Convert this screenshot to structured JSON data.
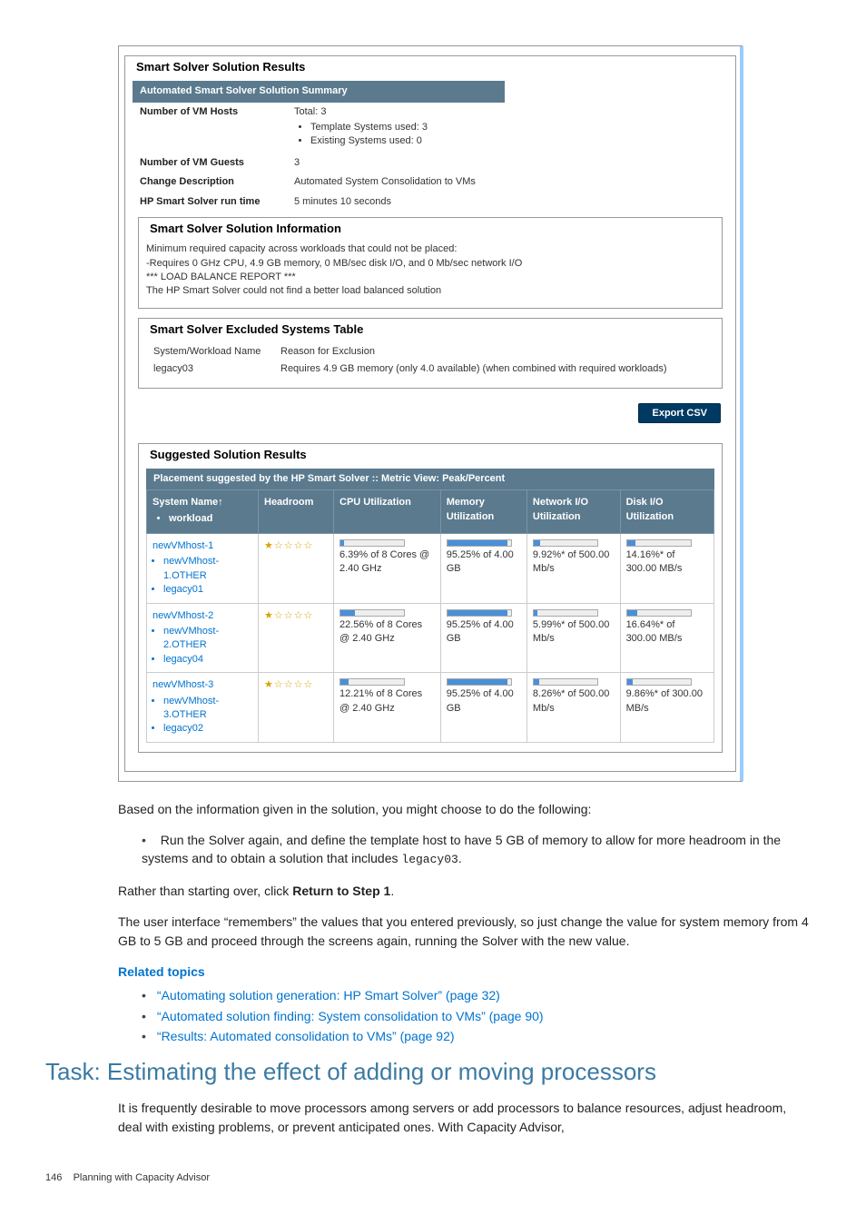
{
  "shot": {
    "mainLegend": "Smart Solver Solution Results",
    "summaryBar": "Automated Smart Solver Solution Summary",
    "vmHostsLabel": "Number of VM Hosts",
    "vmHostsTotal": "Total: 3",
    "vmHostsBullet1": "Template Systems used: 3",
    "vmHostsBullet2": "Existing Systems used: 0",
    "vmGuestsLabel": "Number of VM Guests",
    "vmGuestsVal": "3",
    "changeLabel": "Change Description",
    "changeVal": "Automated System Consolidation to VMs",
    "runLabel": "HP Smart Solver run time",
    "runVal": "5 minutes 10 seconds",
    "infoLegend": "Smart Solver Solution Information",
    "infoL1": "Minimum required capacity across workloads that could not be placed:",
    "infoL2": "-Requires 0 GHz CPU, 4.9 GB memory, 0 MB/sec disk I/O, and 0 Mb/sec network I/O",
    "infoL3": "*** LOAD BALANCE REPORT ***",
    "infoL4": "The HP Smart Solver could not find a better load balanced solution",
    "exclLegend": "Smart Solver Excluded Systems Table",
    "exclH1": "System/Workload Name",
    "exclH2": "Reason for Exclusion",
    "exclR1c1": "legacy03",
    "exclR1c2": "Requires 4.9 GB memory (only 4.0 available) (when combined with required workloads)",
    "exportBtn": "Export CSV",
    "suggLegend": "Suggested Solution Results",
    "placementBar": "Placement suggested by the HP Smart Solver :: Metric View: Peak/Percent",
    "th1a": "System Name↑",
    "th1b": "workload",
    "th2": "Headroom",
    "th3": "CPU Utilization",
    "th4": "Memory Utilization",
    "th5": "Network I/O Utilization",
    "th6": "Disk I/O Utilization",
    "rows": [
      {
        "name": "newVMhost-1",
        "w1": "newVMhost-1.OTHER",
        "w2": "legacy01",
        "cpu_pct": 6.39,
        "cpu_txt": "6.39% of 8 Cores @ 2.40 GHz",
        "mem_pct": 95.25,
        "mem_txt": "95.25% of 4.00  GB",
        "net_pct": 9.92,
        "net_txt": "9.92%* of 500.00 Mb/s",
        "disk_pct": 14.16,
        "disk_txt": "14.16%* of 300.00 MB/s"
      },
      {
        "name": "newVMhost-2",
        "w1": "newVMhost-2.OTHER",
        "w2": "legacy04",
        "cpu_pct": 22.56,
        "cpu_txt": "22.56% of 8 Cores @ 2.40 GHz",
        "mem_pct": 95.25,
        "mem_txt": "95.25% of 4.00  GB",
        "net_pct": 5.99,
        "net_txt": "5.99%* of 500.00 Mb/s",
        "disk_pct": 16.64,
        "disk_txt": "16.64%* of 300.00 MB/s"
      },
      {
        "name": "newVMhost-3",
        "w1": "newVMhost-3.OTHER",
        "w2": "legacy02",
        "cpu_pct": 12.21,
        "cpu_txt": "12.21% of 8 Cores @ 2.40 GHz",
        "mem_pct": 95.25,
        "mem_txt": "95.25% of 4.00  GB",
        "net_pct": 8.26,
        "net_txt": "8.26%* of 500.00 Mb/s",
        "disk_pct": 9.86,
        "disk_txt": "9.86%* of 300.00 MB/s"
      }
    ]
  },
  "body": {
    "p1": "Based on the information given in the solution, you might choose to do the following:",
    "b1a": "Run the Solver again, and define the template host to have 5 GB of memory to allow for more headroom in the systems and to obtain a solution that includes ",
    "b1code": "legacy03",
    "b1b": ".",
    "p2a": "Rather than starting over, click ",
    "p2bold": "Return to Step 1",
    "p2b": ".",
    "p3": "The user interface “remembers” the values that you entered previously, so just change the value for system memory from 4 GB to 5 GB and proceed through the screens again, running the Solver with the new value.",
    "rtTitle": "Related topics",
    "rt1": "“Automating solution generation: HP Smart Solver” (page 32)",
    "rt2": "“Automated solution finding: System consolidation to VMs” (page 90)",
    "rt3": "“Results: Automated consolidation to VMs” (page 92)",
    "taskTitle": "Task: Estimating the effect of adding or moving processors",
    "taskP": "It is frequently desirable to move processors among servers or add processors to balance resources, adjust headroom, deal with existing problems, or prevent anticipated ones. With Capacity Advisor,",
    "footerNum": "146",
    "footerTxt": "Planning with Capacity Advisor"
  }
}
